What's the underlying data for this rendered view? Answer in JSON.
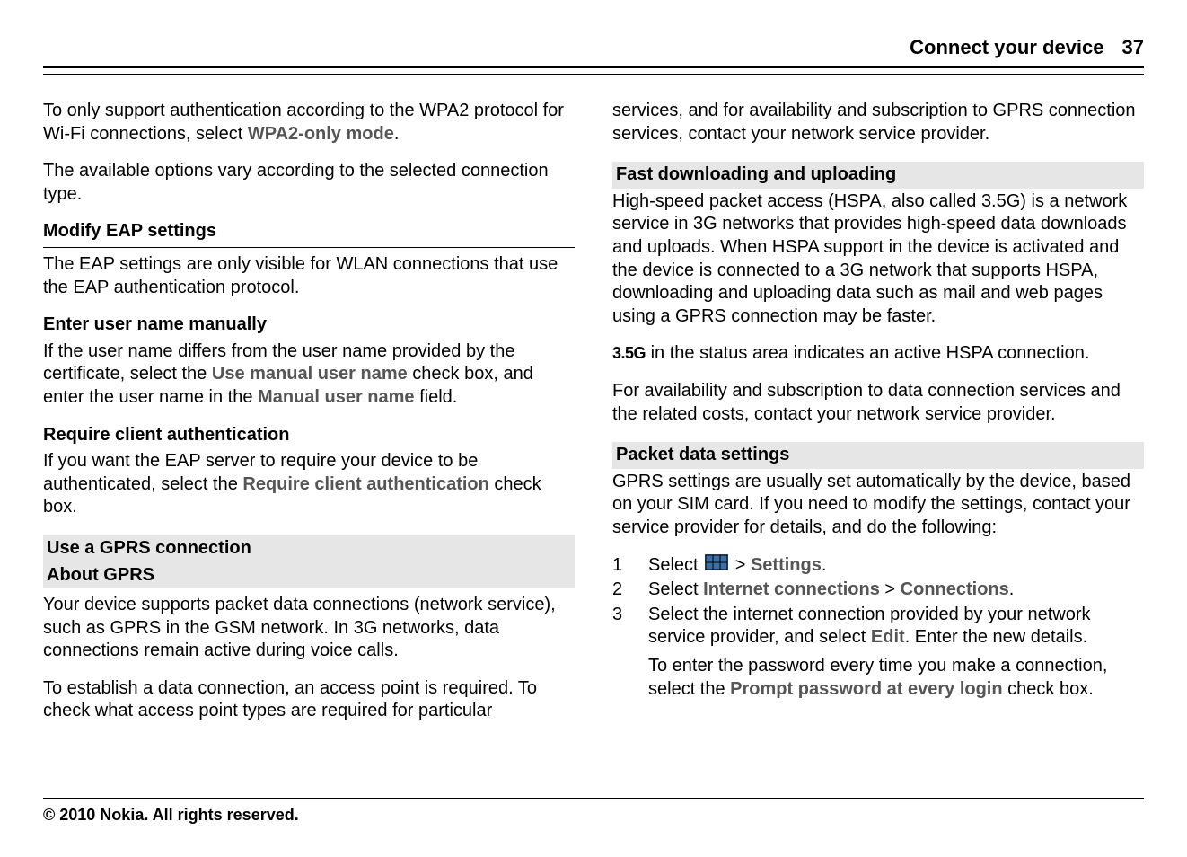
{
  "header": {
    "section": "Connect your device",
    "page_number": "37"
  },
  "left": {
    "p1_pre": "To only support authentication according to the WPA2 protocol for Wi-Fi connections, select ",
    "p1_bold": "WPA2-only mode",
    "p1_post": ".",
    "p2": "The available options vary according to the selected connection type.",
    "h_modify": "Modify EAP settings",
    "p3": "The EAP settings are only visible for WLAN connections that use the EAP authentication protocol.",
    "h_enter": "Enter user name manually",
    "p4_pre": "If the user name differs from the user name provided by the certificate, select the ",
    "p4_b1": "Use manual user name",
    "p4_mid": " check box, and enter the user name in the ",
    "p4_b2": "Manual user name",
    "p4_post": " field.",
    "h_require": "Require client authentication",
    "p5_pre": "If you want the EAP server to require your device to be authenticated, select the ",
    "p5_b": "Require client authentication",
    "p5_post": " check box.",
    "h_use_gprs": "Use a GPRS connection",
    "h_about_gprs": "About GPRS",
    "p6": "Your device supports packet data connections (network service), such as GPRS in the GSM network. In 3G networks, data connections remain active during voice calls.",
    "p7": "To establish a data connection, an access point is required. To check what access point types are required for particular"
  },
  "right": {
    "p1": "services, and for availability and subscription to GPRS connection services, contact your network service provider.",
    "h_fast": "Fast downloading and uploading",
    "p2": "High-speed packet access (HSPA, also called 3.5G) is a network service in 3G networks that provides high-speed data downloads and uploads. When HSPA support in the device is activated and the device is connected to a 3G network that supports HSPA, downloading and uploading data such as mail and web pages using a GPRS connection may be faster.",
    "icon_35g": "3.5G",
    "p3_post": " in the status area indicates an active HSPA connection.",
    "p4": "For availability and subscription to data connection services and the related costs, contact your network service provider.",
    "h_packet": "Packet data settings",
    "p5": "GPRS settings are usually set automatically by the device, based on your SIM card. If you need to modify the settings, contact your service provider for details, and do the following:",
    "steps": {
      "s1_pre": "Select ",
      "s1_mid": " > ",
      "s1_b": "Settings",
      "s1_post": ".",
      "s2_pre": "Select ",
      "s2_b1": "Internet connections",
      "s2_mid": "  > ",
      "s2_b2": "Connections",
      "s2_post": ".",
      "s3_pre": "Select the internet connection provided by your network service provider, and select ",
      "s3_b": "Edit",
      "s3_post": ". Enter the new details.",
      "s3_sub_pre": "To enter the password every time you make a connection, select the ",
      "s3_sub_b": "Prompt password at every login",
      "s3_sub_post": " check box."
    }
  },
  "footer": "© 2010 Nokia. All rights reserved."
}
